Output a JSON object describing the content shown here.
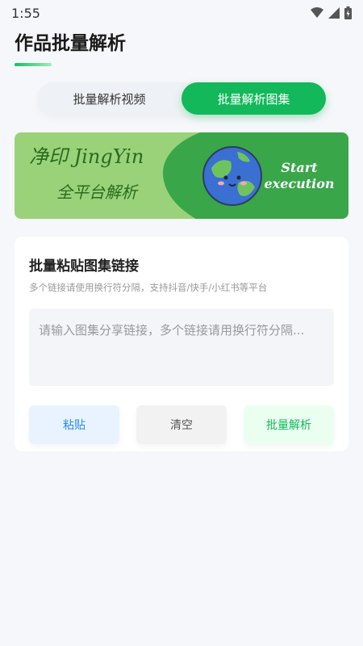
{
  "status": {
    "time": "1:55"
  },
  "header": {
    "title": "作品批量解析"
  },
  "tabs": [
    {
      "label": "批量解析视频",
      "active": false
    },
    {
      "label": "批量解析图集",
      "active": true
    }
  ],
  "banner": {
    "title": "净印 JingYin",
    "subtitle": "全平台解析",
    "cta": "Start execution"
  },
  "card": {
    "title": "批量粘贴图集链接",
    "subtitle": "多个链接请使用换行符分隔，支持抖音/快手/小红书等平台",
    "input_placeholder": "请输入图集分享链接，多个链接请用换行符分隔...",
    "input_value": "",
    "buttons": {
      "paste": "粘贴",
      "clear": "清空",
      "parse": "批量解析"
    }
  },
  "colors": {
    "accent": "#12b85a",
    "paste_text": "#2f88e8"
  }
}
